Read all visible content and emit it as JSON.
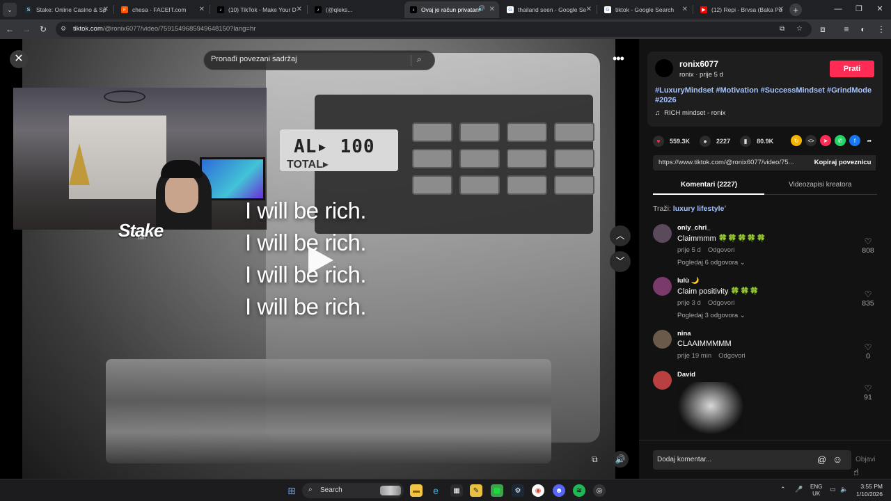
{
  "browser": {
    "tabs": [
      {
        "title": "Stake: Online Casino & Sp",
        "fav_color": "#1a2c38",
        "fav_glyph": "S"
      },
      {
        "title": "chesa - FACEIT.com",
        "fav_color": "#ff5500",
        "fav_glyph": "F"
      },
      {
        "title": "(10) TikTok - Make Your D",
        "fav_color": "#000000",
        "fav_glyph": "♪"
      },
      {
        "title": "(@qleks...",
        "fav_color": "#000000",
        "fav_glyph": "♪"
      },
      {
        "title": "Ovaj je račun privatan",
        "fav_color": "#000000",
        "fav_glyph": "♪",
        "active": true
      },
      {
        "title": "thailand seen - Google Se",
        "fav_color": "#ffffff",
        "fav_glyph": "G"
      },
      {
        "title": "tiktok - Google Search",
        "fav_color": "#ffffff",
        "fav_glyph": "G"
      },
      {
        "title": "(12) Repi - Brvsa (Baka Pa",
        "fav_color": "#ff0000",
        "fav_glyph": "▶"
      }
    ],
    "url_host": "tiktok.com",
    "url_path": "/@ronix6077/video/7591549685949648150?lang=hr"
  },
  "video": {
    "search_placeholder": "Pronađi povezani sadržaj",
    "caption_lines": [
      "I will be rich.",
      "I will be rich.",
      "I will be rich.",
      "I will be rich."
    ],
    "lcd_text": "AL▸ 100",
    "lcd_label": "TOTAL▸",
    "overlay_logo": "Stake",
    "overlay_logo_sub": ".com"
  },
  "post": {
    "username": "ronix6077",
    "subline": "ronix · prije 5 d",
    "follow_label": "Prati",
    "hashtags": "#LuxuryMindset #Motivation #SuccessMindset #GrindMode #2026",
    "music": "RICH mindset - ronix",
    "likes": "559.3K",
    "comments": "2227",
    "saves": "80.9K",
    "link": "https://www.tiktok.com/@ronix6077/video/75...",
    "copy_label": "Kopiraj poveznicu",
    "tab_comments": "Komentari (2227)",
    "tab_creator": "Videozapisi kreatora",
    "search_prefix": "Traži:",
    "search_term": "luxury lifestyle",
    "comment_placeholder": "Dodaj komentar...",
    "post_label": "Objavi"
  },
  "comments": [
    {
      "name": "only_chri_",
      "text": "Claimmmm 🍀🍀🍀🍀🍀",
      "time": "prije 5 d",
      "reply": "Odgovori",
      "replies": "Pogledaj 6 odgovora ⌄",
      "likes": "808",
      "avatar_color": "#5a4a5a"
    },
    {
      "name": "lulù 🌙",
      "text": "Claim positivity 🍀🍀🍀",
      "time": "prije 3 d",
      "reply": "Odgovori",
      "replies": "Pogledaj 3 odgovora ⌄",
      "likes": "835",
      "avatar_color": "#7a3a6a"
    },
    {
      "name": "nina",
      "text": "CLAAIMMMMM",
      "time": "prije 19 min",
      "reply": "Odgovori",
      "replies": "",
      "likes": "0",
      "avatar_color": "#6a5a4a"
    },
    {
      "name": "David",
      "text": "",
      "time": "",
      "reply": "",
      "replies": "",
      "likes": "91",
      "avatar_color": "#b84040"
    }
  ],
  "taskbar": {
    "search_label": "Search",
    "lang_top": "ENG",
    "lang_bottom": "UK",
    "time": "3:55 PM",
    "date": "1/10/2026"
  }
}
